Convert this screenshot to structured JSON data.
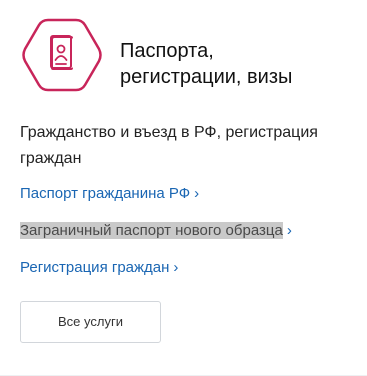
{
  "card": {
    "icon": "passport-icon",
    "title_line1": "Паспорта,",
    "title_line2": "регистрации, визы",
    "subtitle": "Гражданство и въезд в РФ, регистрация граждан",
    "links": [
      {
        "label": "Паспорт гражданина РФ",
        "chevron": "›",
        "state": "normal"
      },
      {
        "label": "Заграничный паспорт нового образца",
        "chevron": "›",
        "state": "highlighted"
      },
      {
        "label": "Регистрация граждан",
        "chevron": "›",
        "state": "normal"
      }
    ],
    "all_services_label": "Все услуги"
  },
  "colors": {
    "icon_accent": "#c8255a",
    "link": "#1a66b3",
    "highlight_bg": "#c9c9c9",
    "button_border": "#d2d6db"
  }
}
